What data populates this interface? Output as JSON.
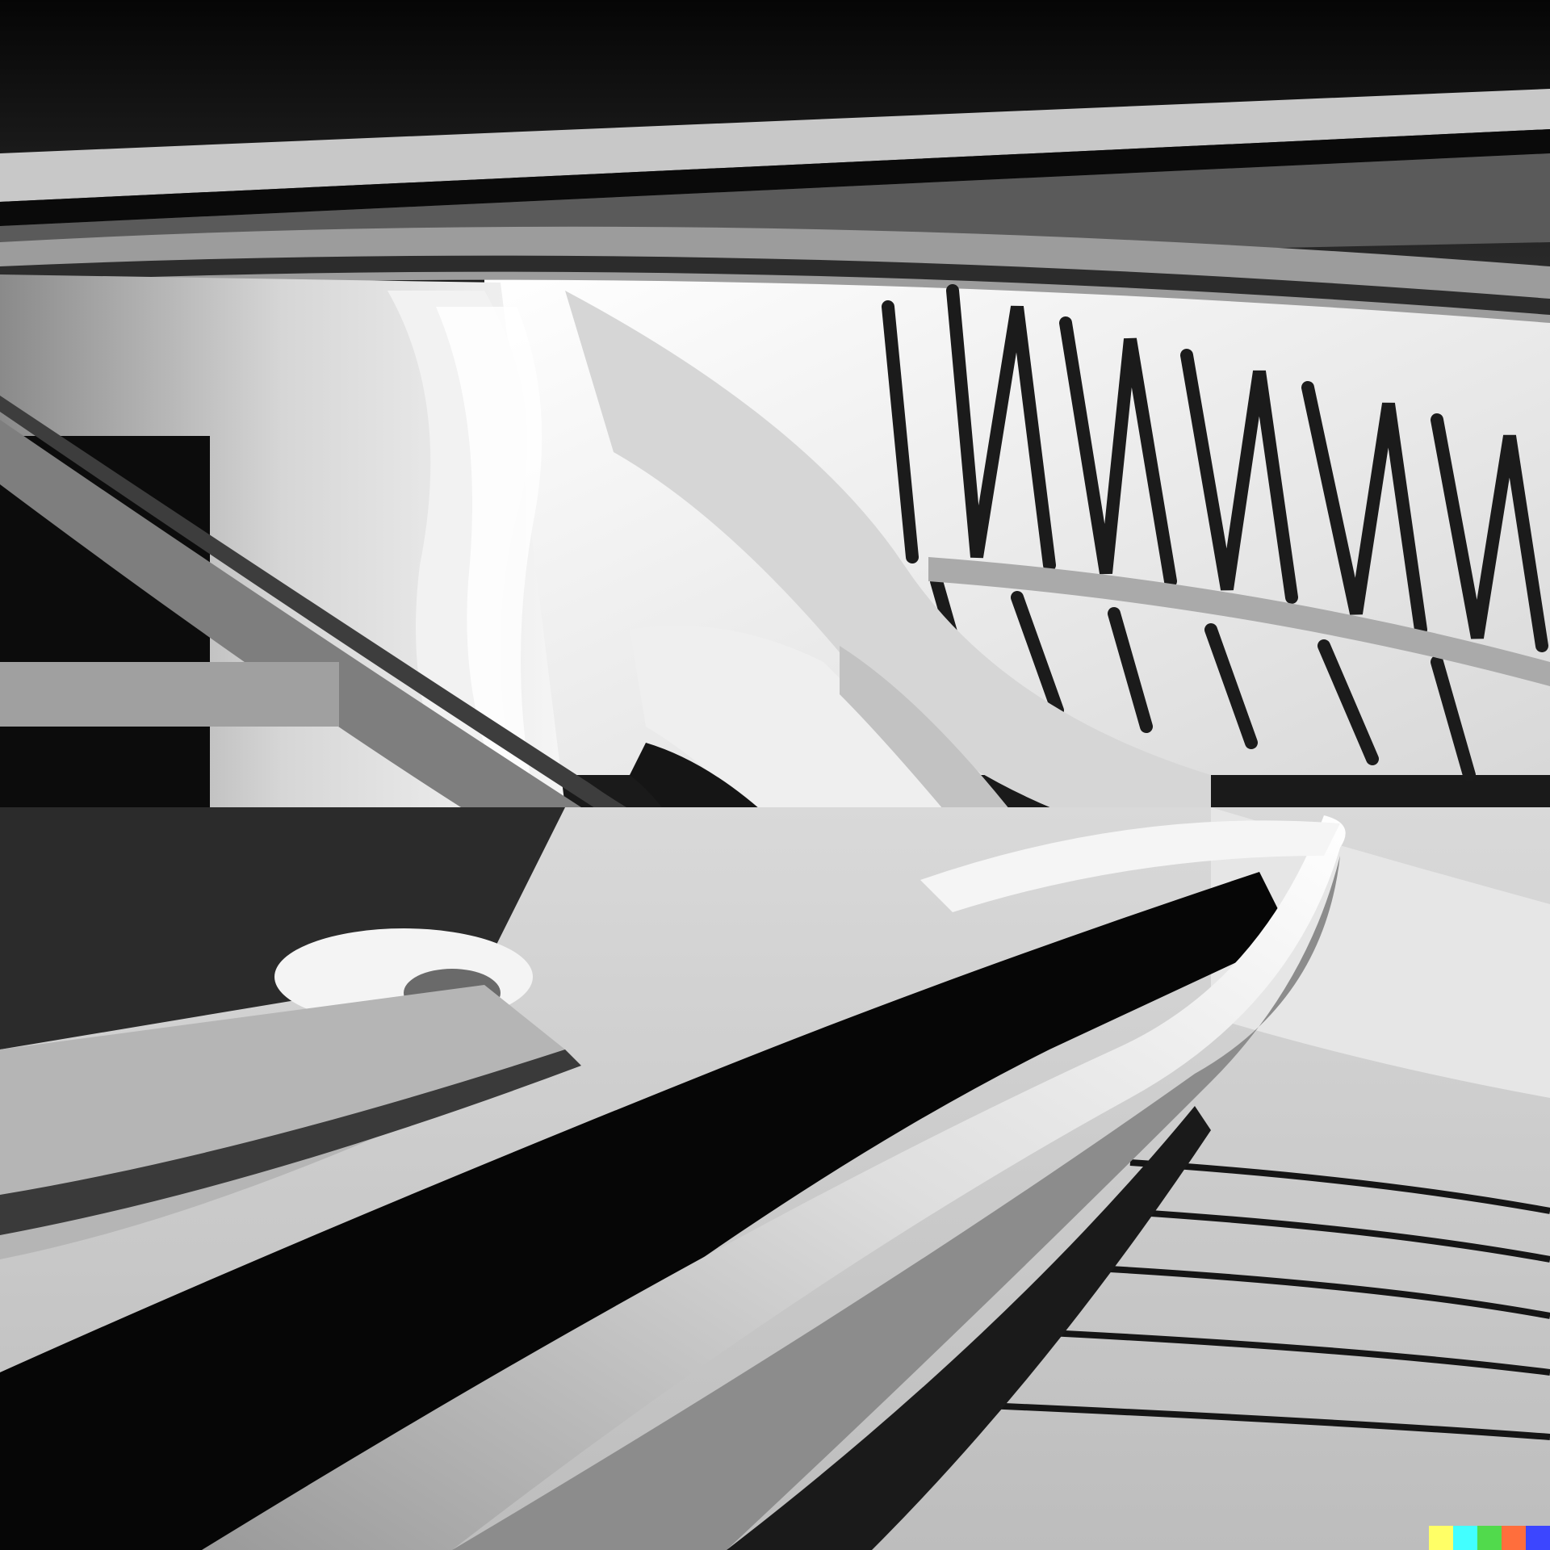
{
  "image": {
    "subject": "",
    "palette": {
      "ceiling": "#0b0b0b",
      "beam_light": "#d2d2d2",
      "beam_mid": "#9a9a9a",
      "beam_dark": "#3a3a3a",
      "sky": "#f4f4f4",
      "lattice": "#1c1c1c",
      "floor": "#c9c9c9",
      "ribbon_black": "#070707",
      "ribbon_white": "#ececec",
      "ribbon_grey": "#8e8e8e"
    }
  },
  "watermark": {
    "colors": [
      "#ffff66",
      "#42ffff",
      "#51da4c",
      "#ff6e3c",
      "#3c46ff"
    ]
  }
}
